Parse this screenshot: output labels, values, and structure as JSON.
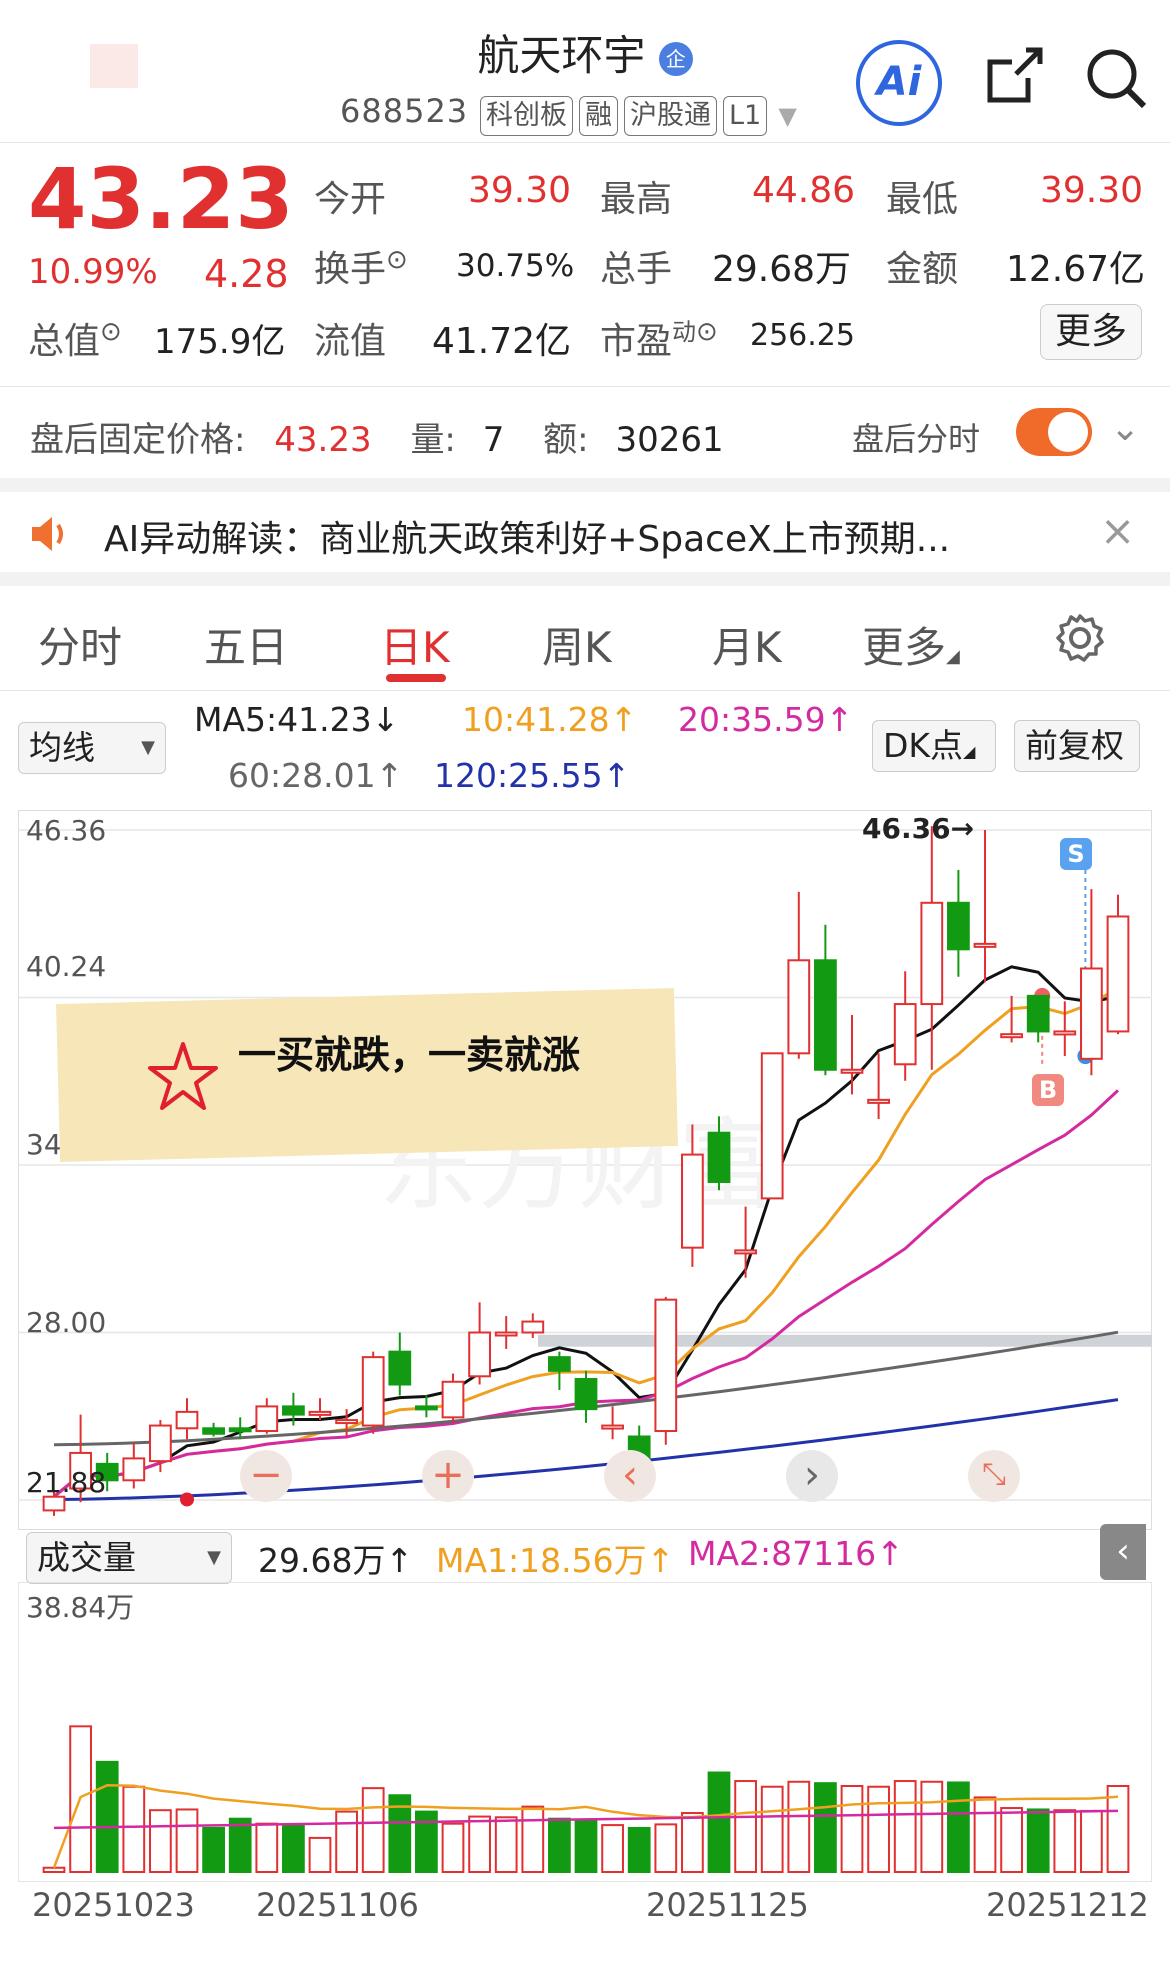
{
  "header": {
    "title": "航天环宇",
    "badge": "企",
    "code": "688523",
    "tags": [
      "科创板",
      "融",
      "沪股通",
      "L1"
    ],
    "ai_label": "Ai"
  },
  "quote": {
    "price": "43.23",
    "pct": "10.99%",
    "chg": "4.28",
    "open_lbl": "今开",
    "open": "39.30",
    "high_lbl": "最高",
    "high": "44.86",
    "low_lbl": "最低",
    "low": "39.30",
    "turn_lbl": "换手",
    "turn": "30.75%",
    "vol_lbl": "总手",
    "vol": "29.68万",
    "amt_lbl": "金额",
    "amt": "12.67亿",
    "mcap_lbl": "总值",
    "mcap": "175.9亿",
    "float_lbl": "流值",
    "float": "41.72亿",
    "pe_lbl": "市盈",
    "pe_sup": "动",
    "pe": "256.25",
    "more": "更多"
  },
  "after": {
    "lbl": "盘后固定价格:",
    "price": "43.23",
    "vol_lbl": "量:",
    "vol": "7",
    "amt_lbl": "额:",
    "amt": "30261",
    "toggle_lbl": "盘后分时"
  },
  "ai_alert": {
    "text": "AI异动解读：商业航天政策利好+SpaceX上市预期..."
  },
  "tabs": [
    "分时",
    "五日",
    "日K",
    "周K",
    "月K",
    "更多"
  ],
  "ma": {
    "selector": "均线",
    "ma5": "MA5:41.23↓",
    "ma10": "10:41.28↑",
    "ma20": "20:35.59↑",
    "ma60": "60:28.01↑",
    "ma120": "120:25.55↑",
    "dk": "DK点",
    "fq": "前复权"
  },
  "chart_labels": {
    "y1": "46.36",
    "y2": "40.24",
    "y3": "34.12",
    "y4": "28.00",
    "y5": "21.88",
    "max": "46.36→",
    "s": "S",
    "b": "B",
    "watermark": "东方财富"
  },
  "note": {
    "text": "一买就跌，一卖就涨"
  },
  "vol_panel": {
    "selector": "成交量",
    "vol": "29.68万↑",
    "ma1": "MA1:18.56万↑",
    "ma2": "MA2:87116↑",
    "ymax": "38.84万"
  },
  "dates": [
    "20251023",
    "20251106",
    "20251125",
    "20251212"
  ],
  "colors": {
    "up": "#e03030",
    "down": "#129a12",
    "ma5": "#111111",
    "ma10": "#f0a020",
    "ma20": "#d42aa0",
    "ma60": "#666666",
    "ma120": "#2233aa"
  },
  "chart_data": {
    "type": "candlestick",
    "ylim": [
      21.88,
      46.36
    ],
    "candles": [
      [
        21.5,
        22.0,
        21.3,
        22.2
      ],
      [
        22.3,
        23.6,
        21.8,
        25.0
      ],
      [
        23.2,
        22.6,
        22.2,
        23.6
      ],
      [
        22.6,
        23.4,
        22.3,
        24.0
      ],
      [
        23.3,
        24.6,
        22.9,
        24.8
      ],
      [
        24.5,
        25.1,
        24.1,
        25.6
      ],
      [
        24.5,
        24.3,
        24.2,
        24.7
      ],
      [
        24.5,
        24.4,
        24.1,
        24.9
      ],
      [
        24.4,
        25.3,
        24.3,
        25.6
      ],
      [
        25.3,
        25.0,
        24.6,
        25.8
      ],
      [
        25.1,
        25.1,
        24.8,
        25.6
      ],
      [
        24.8,
        24.8,
        24.2,
        25.2
      ],
      [
        24.6,
        27.1,
        24.3,
        27.3
      ],
      [
        27.3,
        26.1,
        25.7,
        28.0
      ],
      [
        25.3,
        25.2,
        24.9,
        25.7
      ],
      [
        24.9,
        26.2,
        24.7,
        26.5
      ],
      [
        26.4,
        28.0,
        26.1,
        29.1
      ],
      [
        28.0,
        28.0,
        27.4,
        28.6
      ],
      [
        28.0,
        28.4,
        27.8,
        28.7
      ],
      [
        27.1,
        26.6,
        25.9,
        27.3
      ],
      [
        26.3,
        25.2,
        24.7,
        26.6
      ],
      [
        24.6,
        24.6,
        24.1,
        25.3
      ],
      [
        24.2,
        23.3,
        22.9,
        24.6
      ],
      [
        24.4,
        29.2,
        23.9,
        29.3
      ],
      [
        31.1,
        34.5,
        30.4,
        35.6
      ],
      [
        35.3,
        33.5,
        33.2,
        35.9
      ],
      [
        31.0,
        31.0,
        30.0,
        32.6
      ],
      [
        32.9,
        38.2,
        32.9,
        38.2
      ],
      [
        38.2,
        41.6,
        38.0,
        44.1
      ],
      [
        41.6,
        37.6,
        37.4,
        42.9
      ],
      [
        37.6,
        37.6,
        36.7,
        39.6
      ],
      [
        36.5,
        36.5,
        35.8,
        38.2
      ],
      [
        37.8,
        40.0,
        37.2,
        41.2
      ],
      [
        40.0,
        43.7,
        37.6,
        46.5
      ],
      [
        43.7,
        42.0,
        41.0,
        44.9
      ],
      [
        42.2,
        42.2,
        40.8,
        46.36
      ],
      [
        38.9,
        38.9,
        38.6,
        40.3
      ],
      [
        40.3,
        39.0,
        38.6,
        40.3
      ],
      [
        39.0,
        39.0,
        38.1,
        40.1
      ],
      [
        38.0,
        41.3,
        37.4,
        44.2
      ],
      [
        39.0,
        43.2,
        38.9,
        44.0
      ]
    ],
    "volume": [
      6,
      205,
      155,
      120,
      87,
      88,
      62,
      75,
      68,
      65,
      48,
      85,
      118,
      108,
      85,
      68,
      78,
      77,
      92,
      75,
      74,
      66,
      62,
      67,
      83,
      140,
      128,
      120,
      127,
      125,
      121,
      120,
      128,
      127,
      126,
      105,
      90,
      88,
      87,
      86,
      121
    ],
    "volume_ylim": [
      0,
      38.84
    ],
    "volume_unit": "万"
  }
}
